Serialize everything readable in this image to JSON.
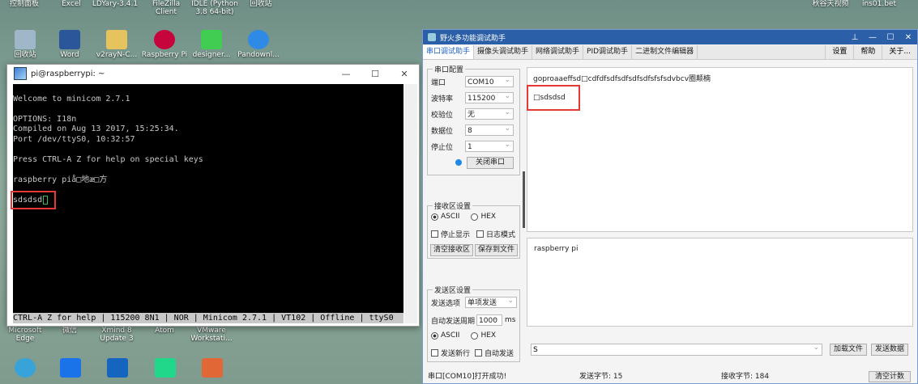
{
  "desktop": {
    "top_labels": [
      "控制面板",
      "Excel",
      "LDYary-3.4.1",
      "FileZilla Client",
      "IDLE (Python 3.8 64-bit)",
      "回收站"
    ],
    "top_right_labels": [
      "秋谷天视频",
      "ins01.bet"
    ],
    "row1": [
      {
        "label": "回收站",
        "icon": "recycle-bin-icon",
        "color": "#9fb7c9"
      },
      {
        "label": "Word",
        "icon": "word-icon",
        "color": "#2b579a"
      },
      {
        "label": "v2rayN-C...",
        "icon": "folder-icon",
        "color": "#e6c35c"
      },
      {
        "label": "Raspberry Pi",
        "icon": "raspberry-icon",
        "color": "#c7053d"
      },
      {
        "label": "designer...",
        "icon": "designer-icon",
        "color": "#41cd52"
      },
      {
        "label": "Pandownl...",
        "icon": "cloud-icon",
        "color": "#2f8ae5"
      }
    ],
    "row2": [
      {
        "label": "Microsoft Edge"
      },
      {
        "label": "微信"
      },
      {
        "label": "Xmind 8 Update 3"
      },
      {
        "label": "Atom"
      },
      {
        "label": "VMware Workstati..."
      }
    ],
    "row3": [
      {
        "icon": "app-icon-1",
        "color": "#38a3d9"
      },
      {
        "icon": "app-icon-2",
        "color": "#1a73e8"
      },
      {
        "icon": "app-icon-3",
        "color": "#1565c0"
      },
      {
        "icon": "pycharm-icon",
        "color": "#21d789"
      },
      {
        "icon": "matlab-icon",
        "color": "#e16737"
      }
    ]
  },
  "putty": {
    "title": "pi@raspberrypi: ~",
    "window_buttons": [
      "—",
      "☐",
      "✕"
    ],
    "lines": [
      "",
      "Welcome to minicom 2.7.1",
      "",
      "OPTIONS: I18n",
      "Compiled on Aug 13 2017, 15:25:34.",
      "Port /dev/ttyS0, 10:32:57",
      "",
      "Press CTRL-A Z for help on special keys",
      "",
      "raspberry piå□地æ□方",
      "",
      "sdsdsd"
    ],
    "status": "CTRL-A Z for help | 115200 8N1 | NOR | Minicom 2.7.1 | VT102 | Offline | ttyS0"
  },
  "serial": {
    "title": "野火多功能调试助手",
    "window_buttons": [
      "⊥",
      "—",
      "☐",
      "✕"
    ],
    "tabs": [
      "串口调试助手",
      "摄像头调试助手",
      "网络调试助手",
      "PID调试助手",
      "二进制文件编辑器"
    ],
    "tab_right": [
      "设置",
      "帮助",
      "关于..."
    ],
    "port_group": {
      "legend": "串口配置",
      "fields": [
        {
          "label": "端口",
          "value": "COM10"
        },
        {
          "label": "波特率",
          "value": "115200"
        },
        {
          "label": "校验位",
          "value": "无"
        },
        {
          "label": "数据位",
          "value": "8"
        },
        {
          "label": "停止位",
          "value": "1"
        }
      ],
      "close_button": "关闭串口"
    },
    "recv_group": {
      "legend": "接收区设置",
      "ascii": "ASCII",
      "hex": "HEX",
      "pause": "停止显示",
      "log": "日志模式",
      "clear_button": "清空接收区",
      "save_button": "保存到文件"
    },
    "send_group": {
      "legend": "发送区设置",
      "option_label": "发送选项",
      "option_value": "单项发送",
      "auto_label": "自动发送周期",
      "auto_value": "1000",
      "auto_unit": "ms",
      "ascii": "ASCII",
      "hex": "HEX",
      "newline": "发送新行",
      "auto_send": "自动发送"
    },
    "recv_text_line1": "goproaaeffsd□cdfdfsdfsdfsdfsdfsfsfsdvbcv圈颠楠",
    "recv_text_line2": "□sdsdsd",
    "send_text": "raspberry pi",
    "input_value": "S",
    "load_button": "加载文件",
    "send_button": "发送数据",
    "status_opened": "串口[COM10]打开成功!",
    "status_sent": "发送字节: 15",
    "status_recv": "接收字节: 184",
    "clear_count_button": "清空计数"
  }
}
